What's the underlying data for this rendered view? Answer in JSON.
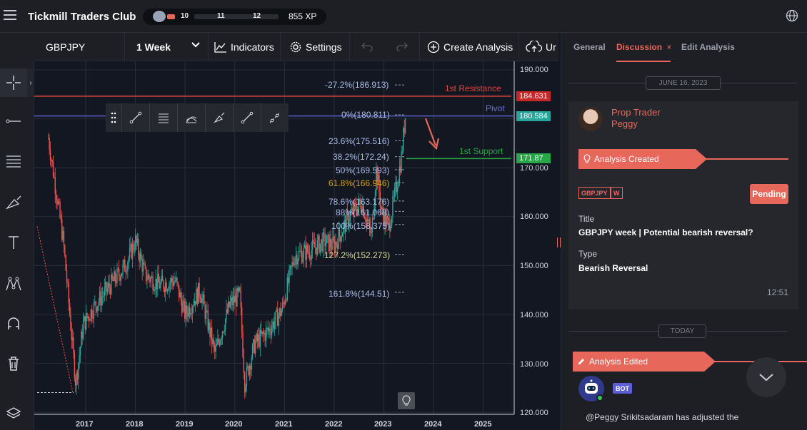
{
  "app": {
    "title": "Tickmill Traders Club",
    "xp": "855 XP",
    "levels": [
      "10",
      "11",
      "12"
    ]
  },
  "toolbar": {
    "symbol": "GBPJPY",
    "interval": "1 Week",
    "indicators": "Indicators",
    "settings": "Settings",
    "create_analysis": "Create Analysis",
    "upload": "Ur"
  },
  "chart": {
    "y_ticks": [
      "190.000",
      "180.000",
      "170.000",
      "160.000",
      "150.000",
      "140.000",
      "130.000",
      "120.000"
    ],
    "x_ticks": [
      "2017",
      "2018",
      "2019",
      "2020",
      "2021",
      "2022",
      "2023",
      "2024",
      "2025"
    ],
    "lines": {
      "resistance": "1st Resistance",
      "pivot": "Pivot",
      "support": "1st Support"
    },
    "price_tags": {
      "resistance": "184.631",
      "pivot": "180.584",
      "support": "171.87"
    },
    "fib_levels": [
      "-27.2%(186.913)",
      "0%(180.811)",
      "23.6%(175.516)",
      "38.2%(172.24)",
      "50%(169.593)",
      "61.8%(166.946)",
      "78.6%(163.176)",
      "88%(161.068)",
      "100%(158.375)",
      "127.2%(152.273)",
      "161.8%(144.51)"
    ],
    "colors": {
      "resistance": "#e0453c",
      "pivot": "#5b5fc7",
      "support": "#26a645",
      "up": "#26a69a",
      "down": "#ef5350",
      "fib_gold": "#d4a017"
    }
  },
  "panel": {
    "tabs": {
      "general": "General",
      "discussion": "Discussion",
      "discussion_close": "×",
      "edit": "Edit Analysis"
    },
    "date1": "JUNE 16, 2023",
    "date2": "TODAY",
    "author_role": "Prop Trader",
    "author_name": "Peggy",
    "created": "Analysis Created",
    "tag1": "GBPJPY",
    "tag2": "W",
    "status": "Pending",
    "title_label": "Title",
    "title_value": "GBPJPY week | Potential bearish reversal?",
    "type_label": "Type",
    "type_value": "Bearish Reversal",
    "time": "12:51",
    "edited": "Analysis Edited",
    "bot": "BOT",
    "bot_msg": "@Peggy Srikitsadaram  has adjusted the"
  }
}
